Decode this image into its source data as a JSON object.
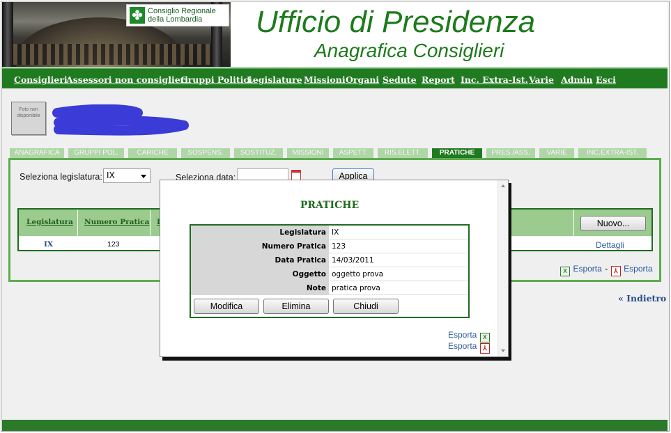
{
  "header": {
    "logo_line1": "Consiglio Regionale",
    "logo_line2": "della Lombardia",
    "title": "Ufficio di Presidenza",
    "subtitle": "Anagrafica Consiglieri"
  },
  "menu": [
    "Consiglieri",
    "Assessori non consiglieri",
    "Gruppi Politici",
    "Legislature",
    "Missioni",
    "Organi",
    "Sedute",
    "Report",
    "Inc. Extra-Ist.",
    "Varie",
    "Admin",
    "Esci"
  ],
  "person": {
    "photo_placeholder": "Foto non disponibile"
  },
  "tabs": [
    "ANAGRAFICA",
    "GRUPPI POL.",
    "CARICHE",
    "SOSPENS.",
    "SOSTITUZ.",
    "MISSIONI",
    "ASPETT.",
    "RIS.ELETT.",
    "PRATICHE",
    "PRES./ASS.",
    "VARIE",
    "INC.EXTRA-IST."
  ],
  "active_tab": "PRATICHE",
  "filters": {
    "legislatura_label": "Seleziona legislatura:",
    "legislatura_value": "IX",
    "data_label": "Seleziona data:",
    "data_value": "",
    "apply_label": "Applica"
  },
  "table": {
    "columns": [
      "Legislatura",
      "Numero Pratica",
      "D"
    ],
    "rows": [
      {
        "legislatura": "IX",
        "numero": "123",
        "action": "Dettagli"
      }
    ],
    "new_button": "Nuovo..."
  },
  "exports": {
    "label": "Esporta",
    "separator": "-"
  },
  "back_link": "« Indietro",
  "modal": {
    "title": "PRATICHE",
    "fields": [
      {
        "label": "Legislatura",
        "value": "IX"
      },
      {
        "label": "Numero Pratica",
        "value": "123"
      },
      {
        "label": "Data Pratica",
        "value": "14/03/2011"
      },
      {
        "label": "Oggetto",
        "value": "oggetto prova"
      },
      {
        "label": "Note",
        "value": "pratica prova"
      }
    ],
    "buttons": {
      "edit": "Modifica",
      "delete": "Elimina",
      "close": "Chiudi"
    },
    "export_excel": "Esporta",
    "export_pdf": "Esporta"
  },
  "colors": {
    "brand_green": "#207a20",
    "tab_inactive": "#aed6a6",
    "table_header": "#9bcb8e",
    "link_blue": "#2a5a9a"
  },
  "icons": {
    "excel": "excel-icon",
    "pdf": "pdf-icon",
    "calendar": "calendar-icon"
  }
}
